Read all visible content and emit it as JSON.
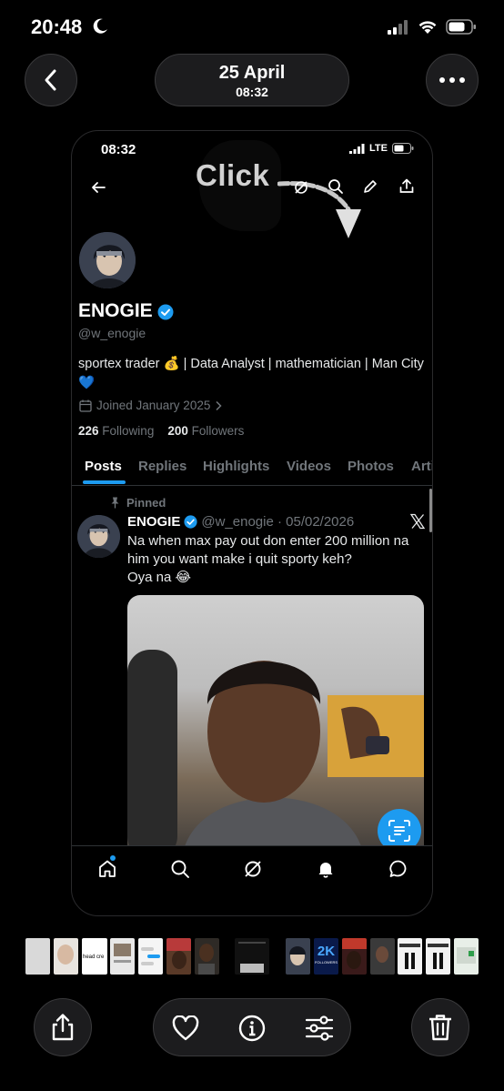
{
  "os_status": {
    "time": "20:48",
    "moon_icon": "moon-icon",
    "signal_icon": "cellular-signal-icon",
    "wifi_icon": "wifi-icon",
    "battery_icon": "battery-icon"
  },
  "header": {
    "back_icon": "chevron-left-icon",
    "date": "25 April",
    "time": "08:32",
    "more_icon": "ellipsis-icon"
  },
  "screenshot": {
    "status_time": "08:32",
    "network": "LTE",
    "overlay_text": "Click",
    "toolbar_icons": [
      "back-arrow-icon",
      "grok-icon",
      "search-icon",
      "edit-icon",
      "share-icon"
    ],
    "profile": {
      "name": "ENOGIE",
      "handle": "@w_enogie",
      "bio": "sportex trader 💰 | Data Analyst | mathematician | Man City 💙",
      "joined": "Joined January 2025",
      "following_count": "226",
      "following_label": "Following",
      "followers_count": "200",
      "followers_label": "Followers"
    },
    "tabs": [
      "Posts",
      "Replies",
      "Highlights",
      "Videos",
      "Photos",
      "Arti"
    ],
    "active_tab": "Posts",
    "post": {
      "pinned_label": "Pinned",
      "author": "ENOGIE",
      "meta": "@w_enogie · 05/02/2026",
      "text_lines": [
        "Na when max pay out don enter 200 million na",
        "him you want make i quit sporty keh?",
        "Oya na 😂"
      ]
    },
    "bottom_nav_icons": [
      "home-icon",
      "search-icon",
      "grok-icon",
      "notifications-icon",
      "messages-icon"
    ]
  },
  "thumbnail_text": "head cre",
  "thumbnail_badge": "2K",
  "thumbnail_badge_sub": "FOLLOWERS",
  "actions": {
    "share_icon": "share-icon",
    "like_icon": "heart-icon",
    "info_icon": "info-icon",
    "adjust_icon": "sliders-icon",
    "delete_icon": "trash-icon"
  },
  "colors": {
    "accent": "#1d9bf0",
    "background": "#000000",
    "muted_text": "#71767b",
    "control_bg": "#1c1c1e"
  }
}
